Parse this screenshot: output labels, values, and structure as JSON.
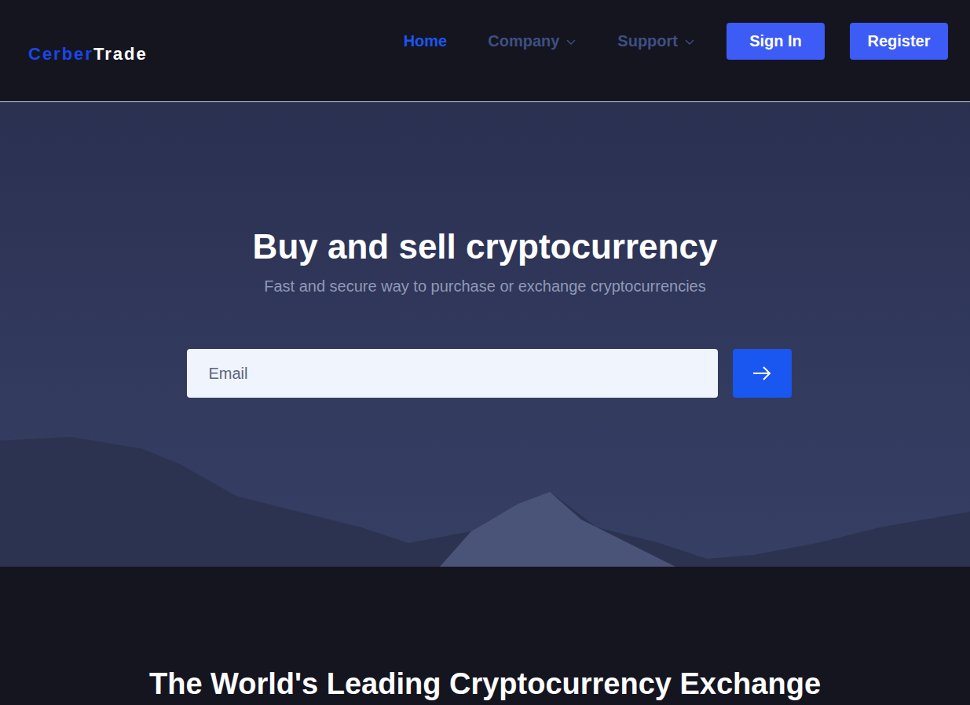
{
  "header": {
    "logo": {
      "primary": "Cerber",
      "secondary": "Trade"
    },
    "nav": [
      {
        "label": "Home",
        "selected": true,
        "kind": "link"
      },
      {
        "label": "Company",
        "selected": false,
        "kind": "dropdown"
      },
      {
        "label": "Support",
        "selected": false,
        "kind": "dropdown"
      }
    ],
    "buttons": [
      "Sign In",
      "Register"
    ]
  },
  "hero": {
    "title": "Buy and sell cryptocurrency",
    "subtitle": "Fast and secure way to purchase or exchange cryptocurrencies",
    "email": {
      "placeholder": "Email"
    }
  },
  "section": {
    "title": "The World's Leading Cryptocurrency Exchange"
  }
}
